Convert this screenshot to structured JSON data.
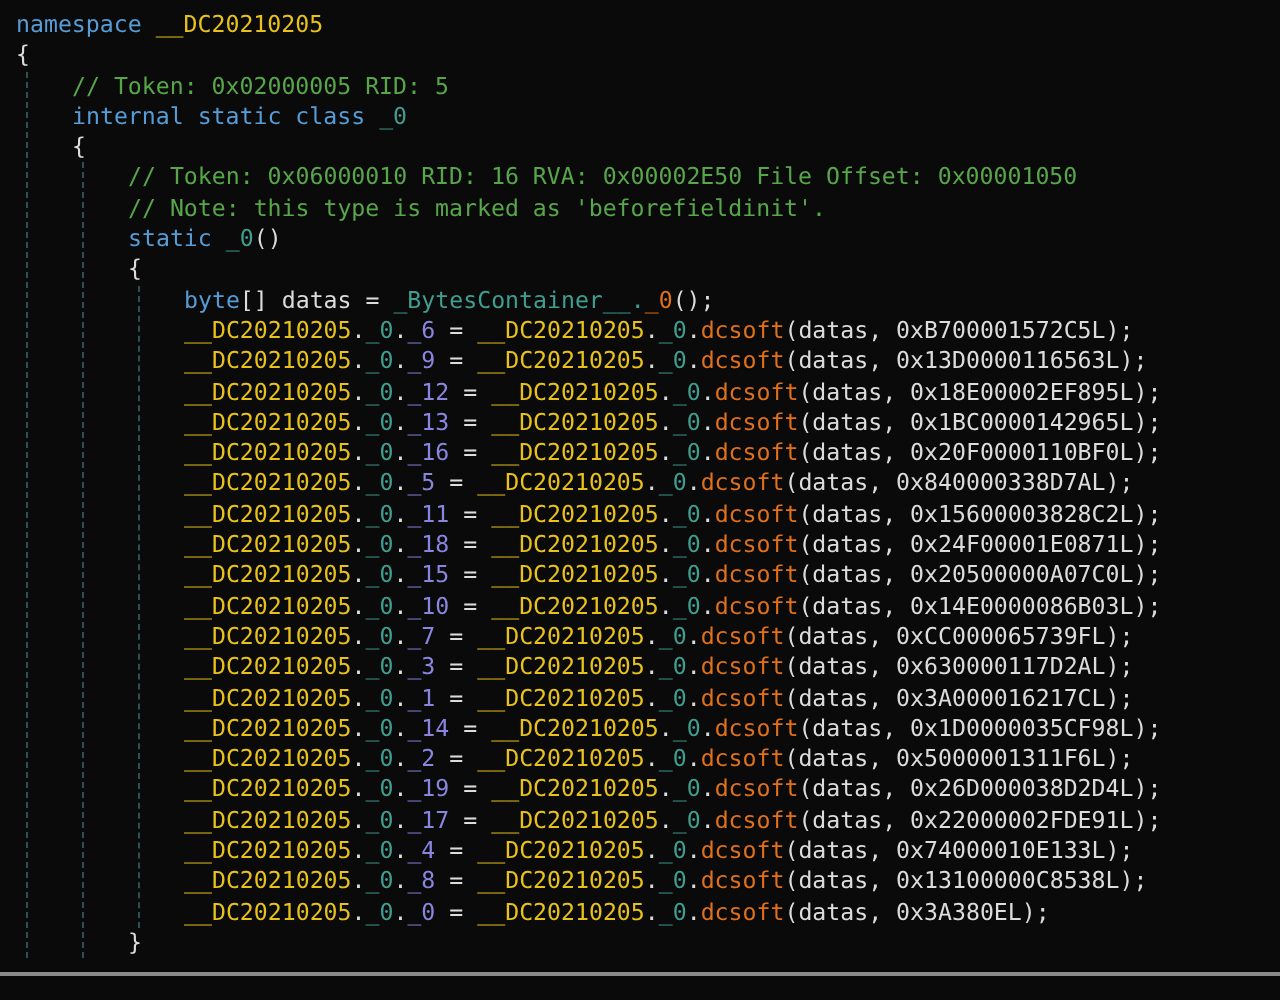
{
  "code_lines": [
    {
      "tokens": [
        {
          "kind": "kw",
          "text": "namespace "
        },
        {
          "kind": "type",
          "text": "__DC20210205"
        }
      ]
    },
    {
      "tokens": [
        {
          "kind": "text",
          "text": "{"
        }
      ],
      "children": [
        {
          "tokens": [
            {
              "kind": "comment",
              "text": "// Token: 0x02000005 RID: 5"
            }
          ]
        },
        {
          "tokens": [
            {
              "kind": "kw",
              "text": "internal static class "
            },
            {
              "kind": "cls",
              "text": "_0"
            }
          ]
        },
        {
          "tokens": [
            {
              "kind": "text",
              "text": "{"
            }
          ],
          "children": [
            {
              "tokens": [
                {
                  "kind": "comment",
                  "text": "// Token: 0x06000010 RID: 16 RVA: 0x00002E50 File Offset: 0x00001050"
                }
              ]
            },
            {
              "tokens": [
                {
                  "kind": "comment",
                  "text": "// Note: this type is marked as 'beforefieldinit'."
                }
              ]
            },
            {
              "tokens": [
                {
                  "kind": "kw",
                  "text": "static "
                },
                {
                  "kind": "cls",
                  "text": "_0"
                },
                {
                  "kind": "text",
                  "text": "()"
                }
              ]
            },
            {
              "tokens": [
                {
                  "kind": "text",
                  "text": "{"
                }
              ],
              "children": [
                {
                  "tokens": [
                    {
                      "kind": "kw",
                      "text": "byte"
                    },
                    {
                      "kind": "text",
                      "text": "[] datas = "
                    },
                    {
                      "kind": "cls",
                      "text": "_BytesContainer__."
                    },
                    {
                      "kind": "method",
                      "text": "_0"
                    },
                    {
                      "kind": "text",
                      "text": "();"
                    }
                  ]
                },
                {
                  "tokens": [
                    {
                      "kind": "type",
                      "text": "__DC20210205"
                    },
                    {
                      "kind": "text",
                      "text": "."
                    },
                    {
                      "kind": "cls",
                      "text": "_0"
                    },
                    {
                      "kind": "text",
                      "text": "."
                    },
                    {
                      "kind": "field",
                      "text": "_6"
                    },
                    {
                      "kind": "text",
                      "text": " = "
                    },
                    {
                      "kind": "type",
                      "text": "__DC20210205"
                    },
                    {
                      "kind": "text",
                      "text": "."
                    },
                    {
                      "kind": "cls",
                      "text": "_0"
                    },
                    {
                      "kind": "text",
                      "text": "."
                    },
                    {
                      "kind": "method",
                      "text": "dcsoft"
                    },
                    {
                      "kind": "text",
                      "text": "(datas, 0xB700001572C5L);"
                    }
                  ]
                },
                {
                  "tokens": [
                    {
                      "kind": "type",
                      "text": "__DC20210205"
                    },
                    {
                      "kind": "text",
                      "text": "."
                    },
                    {
                      "kind": "cls",
                      "text": "_0"
                    },
                    {
                      "kind": "text",
                      "text": "."
                    },
                    {
                      "kind": "field",
                      "text": "_9"
                    },
                    {
                      "kind": "text",
                      "text": " = "
                    },
                    {
                      "kind": "type",
                      "text": "__DC20210205"
                    },
                    {
                      "kind": "text",
                      "text": "."
                    },
                    {
                      "kind": "cls",
                      "text": "_0"
                    },
                    {
                      "kind": "text",
                      "text": "."
                    },
                    {
                      "kind": "method",
                      "text": "dcsoft"
                    },
                    {
                      "kind": "text",
                      "text": "(datas, 0x13D0000116563L);"
                    }
                  ]
                },
                {
                  "tokens": [
                    {
                      "kind": "type",
                      "text": "__DC20210205"
                    },
                    {
                      "kind": "text",
                      "text": "."
                    },
                    {
                      "kind": "cls",
                      "text": "_0"
                    },
                    {
                      "kind": "text",
                      "text": "."
                    },
                    {
                      "kind": "field",
                      "text": "_12"
                    },
                    {
                      "kind": "text",
                      "text": " = "
                    },
                    {
                      "kind": "type",
                      "text": "__DC20210205"
                    },
                    {
                      "kind": "text",
                      "text": "."
                    },
                    {
                      "kind": "cls",
                      "text": "_0"
                    },
                    {
                      "kind": "text",
                      "text": "."
                    },
                    {
                      "kind": "method",
                      "text": "dcsoft"
                    },
                    {
                      "kind": "text",
                      "text": "(datas, 0x18E00002EF895L);"
                    }
                  ]
                },
                {
                  "tokens": [
                    {
                      "kind": "type",
                      "text": "__DC20210205"
                    },
                    {
                      "kind": "text",
                      "text": "."
                    },
                    {
                      "kind": "cls",
                      "text": "_0"
                    },
                    {
                      "kind": "text",
                      "text": "."
                    },
                    {
                      "kind": "field",
                      "text": "_13"
                    },
                    {
                      "kind": "text",
                      "text": " = "
                    },
                    {
                      "kind": "type",
                      "text": "__DC20210205"
                    },
                    {
                      "kind": "text",
                      "text": "."
                    },
                    {
                      "kind": "cls",
                      "text": "_0"
                    },
                    {
                      "kind": "text",
                      "text": "."
                    },
                    {
                      "kind": "method",
                      "text": "dcsoft"
                    },
                    {
                      "kind": "text",
                      "text": "(datas, 0x1BC0000142965L);"
                    }
                  ]
                },
                {
                  "tokens": [
                    {
                      "kind": "type",
                      "text": "__DC20210205"
                    },
                    {
                      "kind": "text",
                      "text": "."
                    },
                    {
                      "kind": "cls",
                      "text": "_0"
                    },
                    {
                      "kind": "text",
                      "text": "."
                    },
                    {
                      "kind": "field",
                      "text": "_16"
                    },
                    {
                      "kind": "text",
                      "text": " = "
                    },
                    {
                      "kind": "type",
                      "text": "__DC20210205"
                    },
                    {
                      "kind": "text",
                      "text": "."
                    },
                    {
                      "kind": "cls",
                      "text": "_0"
                    },
                    {
                      "kind": "text",
                      "text": "."
                    },
                    {
                      "kind": "method",
                      "text": "dcsoft"
                    },
                    {
                      "kind": "text",
                      "text": "(datas, 0x20F0000110BF0L);"
                    }
                  ]
                },
                {
                  "tokens": [
                    {
                      "kind": "type",
                      "text": "__DC20210205"
                    },
                    {
                      "kind": "text",
                      "text": "."
                    },
                    {
                      "kind": "cls",
                      "text": "_0"
                    },
                    {
                      "kind": "text",
                      "text": "."
                    },
                    {
                      "kind": "field",
                      "text": "_5"
                    },
                    {
                      "kind": "text",
                      "text": " = "
                    },
                    {
                      "kind": "type",
                      "text": "__DC20210205"
                    },
                    {
                      "kind": "text",
                      "text": "."
                    },
                    {
                      "kind": "cls",
                      "text": "_0"
                    },
                    {
                      "kind": "text",
                      "text": "."
                    },
                    {
                      "kind": "method",
                      "text": "dcsoft"
                    },
                    {
                      "kind": "text",
                      "text": "(datas, 0x840000338D7AL);"
                    }
                  ]
                },
                {
                  "tokens": [
                    {
                      "kind": "type",
                      "text": "__DC20210205"
                    },
                    {
                      "kind": "text",
                      "text": "."
                    },
                    {
                      "kind": "cls",
                      "text": "_0"
                    },
                    {
                      "kind": "text",
                      "text": "."
                    },
                    {
                      "kind": "field",
                      "text": "_11"
                    },
                    {
                      "kind": "text",
                      "text": " = "
                    },
                    {
                      "kind": "type",
                      "text": "__DC20210205"
                    },
                    {
                      "kind": "text",
                      "text": "."
                    },
                    {
                      "kind": "cls",
                      "text": "_0"
                    },
                    {
                      "kind": "text",
                      "text": "."
                    },
                    {
                      "kind": "method",
                      "text": "dcsoft"
                    },
                    {
                      "kind": "text",
                      "text": "(datas, 0x15600003828C2L);"
                    }
                  ]
                },
                {
                  "tokens": [
                    {
                      "kind": "type",
                      "text": "__DC20210205"
                    },
                    {
                      "kind": "text",
                      "text": "."
                    },
                    {
                      "kind": "cls",
                      "text": "_0"
                    },
                    {
                      "kind": "text",
                      "text": "."
                    },
                    {
                      "kind": "field",
                      "text": "_18"
                    },
                    {
                      "kind": "text",
                      "text": " = "
                    },
                    {
                      "kind": "type",
                      "text": "__DC20210205"
                    },
                    {
                      "kind": "text",
                      "text": "."
                    },
                    {
                      "kind": "cls",
                      "text": "_0"
                    },
                    {
                      "kind": "text",
                      "text": "."
                    },
                    {
                      "kind": "method",
                      "text": "dcsoft"
                    },
                    {
                      "kind": "text",
                      "text": "(datas, 0x24F00001E0871L);"
                    }
                  ]
                },
                {
                  "tokens": [
                    {
                      "kind": "type",
                      "text": "__DC20210205"
                    },
                    {
                      "kind": "text",
                      "text": "."
                    },
                    {
                      "kind": "cls",
                      "text": "_0"
                    },
                    {
                      "kind": "text",
                      "text": "."
                    },
                    {
                      "kind": "field",
                      "text": "_15"
                    },
                    {
                      "kind": "text",
                      "text": " = "
                    },
                    {
                      "kind": "type",
                      "text": "__DC20210205"
                    },
                    {
                      "kind": "text",
                      "text": "."
                    },
                    {
                      "kind": "cls",
                      "text": "_0"
                    },
                    {
                      "kind": "text",
                      "text": "."
                    },
                    {
                      "kind": "method",
                      "text": "dcsoft"
                    },
                    {
                      "kind": "text",
                      "text": "(datas, 0x20500000A07C0L);"
                    }
                  ]
                },
                {
                  "tokens": [
                    {
                      "kind": "type",
                      "text": "__DC20210205"
                    },
                    {
                      "kind": "text",
                      "text": "."
                    },
                    {
                      "kind": "cls",
                      "text": "_0"
                    },
                    {
                      "kind": "text",
                      "text": "."
                    },
                    {
                      "kind": "field",
                      "text": "_10"
                    },
                    {
                      "kind": "text",
                      "text": " = "
                    },
                    {
                      "kind": "type",
                      "text": "__DC20210205"
                    },
                    {
                      "kind": "text",
                      "text": "."
                    },
                    {
                      "kind": "cls",
                      "text": "_0"
                    },
                    {
                      "kind": "text",
                      "text": "."
                    },
                    {
                      "kind": "method",
                      "text": "dcsoft"
                    },
                    {
                      "kind": "text",
                      "text": "(datas, 0x14E0000086B03L);"
                    }
                  ]
                },
                {
                  "tokens": [
                    {
                      "kind": "type",
                      "text": "__DC20210205"
                    },
                    {
                      "kind": "text",
                      "text": "."
                    },
                    {
                      "kind": "cls",
                      "text": "_0"
                    },
                    {
                      "kind": "text",
                      "text": "."
                    },
                    {
                      "kind": "field",
                      "text": "_7"
                    },
                    {
                      "kind": "text",
                      "text": " = "
                    },
                    {
                      "kind": "type",
                      "text": "__DC20210205"
                    },
                    {
                      "kind": "text",
                      "text": "."
                    },
                    {
                      "kind": "cls",
                      "text": "_0"
                    },
                    {
                      "kind": "text",
                      "text": "."
                    },
                    {
                      "kind": "method",
                      "text": "dcsoft"
                    },
                    {
                      "kind": "text",
                      "text": "(datas, 0xCC000065739FL);"
                    }
                  ]
                },
                {
                  "tokens": [
                    {
                      "kind": "type",
                      "text": "__DC20210205"
                    },
                    {
                      "kind": "text",
                      "text": "."
                    },
                    {
                      "kind": "cls",
                      "text": "_0"
                    },
                    {
                      "kind": "text",
                      "text": "."
                    },
                    {
                      "kind": "field",
                      "text": "_3"
                    },
                    {
                      "kind": "text",
                      "text": " = "
                    },
                    {
                      "kind": "type",
                      "text": "__DC20210205"
                    },
                    {
                      "kind": "text",
                      "text": "."
                    },
                    {
                      "kind": "cls",
                      "text": "_0"
                    },
                    {
                      "kind": "text",
                      "text": "."
                    },
                    {
                      "kind": "method",
                      "text": "dcsoft"
                    },
                    {
                      "kind": "text",
                      "text": "(datas, 0x630000117D2AL);"
                    }
                  ]
                },
                {
                  "tokens": [
                    {
                      "kind": "type",
                      "text": "__DC20210205"
                    },
                    {
                      "kind": "text",
                      "text": "."
                    },
                    {
                      "kind": "cls",
                      "text": "_0"
                    },
                    {
                      "kind": "text",
                      "text": "."
                    },
                    {
                      "kind": "field",
                      "text": "_1"
                    },
                    {
                      "kind": "text",
                      "text": " = "
                    },
                    {
                      "kind": "type",
                      "text": "__DC20210205"
                    },
                    {
                      "kind": "text",
                      "text": "."
                    },
                    {
                      "kind": "cls",
                      "text": "_0"
                    },
                    {
                      "kind": "text",
                      "text": "."
                    },
                    {
                      "kind": "method",
                      "text": "dcsoft"
                    },
                    {
                      "kind": "text",
                      "text": "(datas, 0x3A000016217CL);"
                    }
                  ]
                },
                {
                  "tokens": [
                    {
                      "kind": "type",
                      "text": "__DC20210205"
                    },
                    {
                      "kind": "text",
                      "text": "."
                    },
                    {
                      "kind": "cls",
                      "text": "_0"
                    },
                    {
                      "kind": "text",
                      "text": "."
                    },
                    {
                      "kind": "field",
                      "text": "_14"
                    },
                    {
                      "kind": "text",
                      "text": " = "
                    },
                    {
                      "kind": "type",
                      "text": "__DC20210205"
                    },
                    {
                      "kind": "text",
                      "text": "."
                    },
                    {
                      "kind": "cls",
                      "text": "_0"
                    },
                    {
                      "kind": "text",
                      "text": "."
                    },
                    {
                      "kind": "method",
                      "text": "dcsoft"
                    },
                    {
                      "kind": "text",
                      "text": "(datas, 0x1D0000035CF98L);"
                    }
                  ]
                },
                {
                  "tokens": [
                    {
                      "kind": "type",
                      "text": "__DC20210205"
                    },
                    {
                      "kind": "text",
                      "text": "."
                    },
                    {
                      "kind": "cls",
                      "text": "_0"
                    },
                    {
                      "kind": "text",
                      "text": "."
                    },
                    {
                      "kind": "field",
                      "text": "_2"
                    },
                    {
                      "kind": "text",
                      "text": " = "
                    },
                    {
                      "kind": "type",
                      "text": "__DC20210205"
                    },
                    {
                      "kind": "text",
                      "text": "."
                    },
                    {
                      "kind": "cls",
                      "text": "_0"
                    },
                    {
                      "kind": "text",
                      "text": "."
                    },
                    {
                      "kind": "method",
                      "text": "dcsoft"
                    },
                    {
                      "kind": "text",
                      "text": "(datas, 0x5000001311F6L);"
                    }
                  ]
                },
                {
                  "tokens": [
                    {
                      "kind": "type",
                      "text": "__DC20210205"
                    },
                    {
                      "kind": "text",
                      "text": "."
                    },
                    {
                      "kind": "cls",
                      "text": "_0"
                    },
                    {
                      "kind": "text",
                      "text": "."
                    },
                    {
                      "kind": "field",
                      "text": "_19"
                    },
                    {
                      "kind": "text",
                      "text": " = "
                    },
                    {
                      "kind": "type",
                      "text": "__DC20210205"
                    },
                    {
                      "kind": "text",
                      "text": "."
                    },
                    {
                      "kind": "cls",
                      "text": "_0"
                    },
                    {
                      "kind": "text",
                      "text": "."
                    },
                    {
                      "kind": "method",
                      "text": "dcsoft"
                    },
                    {
                      "kind": "text",
                      "text": "(datas, 0x26D000038D2D4L);"
                    }
                  ]
                },
                {
                  "tokens": [
                    {
                      "kind": "type",
                      "text": "__DC20210205"
                    },
                    {
                      "kind": "text",
                      "text": "."
                    },
                    {
                      "kind": "cls",
                      "text": "_0"
                    },
                    {
                      "kind": "text",
                      "text": "."
                    },
                    {
                      "kind": "field",
                      "text": "_17"
                    },
                    {
                      "kind": "text",
                      "text": " = "
                    },
                    {
                      "kind": "type",
                      "text": "__DC20210205"
                    },
                    {
                      "kind": "text",
                      "text": "."
                    },
                    {
                      "kind": "cls",
                      "text": "_0"
                    },
                    {
                      "kind": "text",
                      "text": "."
                    },
                    {
                      "kind": "method",
                      "text": "dcsoft"
                    },
                    {
                      "kind": "text",
                      "text": "(datas, 0x22000002FDE91L);"
                    }
                  ]
                },
                {
                  "tokens": [
                    {
                      "kind": "type",
                      "text": "__DC20210205"
                    },
                    {
                      "kind": "text",
                      "text": "."
                    },
                    {
                      "kind": "cls",
                      "text": "_0"
                    },
                    {
                      "kind": "text",
                      "text": "."
                    },
                    {
                      "kind": "field",
                      "text": "_4"
                    },
                    {
                      "kind": "text",
                      "text": " = "
                    },
                    {
                      "kind": "type",
                      "text": "__DC20210205"
                    },
                    {
                      "kind": "text",
                      "text": "."
                    },
                    {
                      "kind": "cls",
                      "text": "_0"
                    },
                    {
                      "kind": "text",
                      "text": "."
                    },
                    {
                      "kind": "method",
                      "text": "dcsoft"
                    },
                    {
                      "kind": "text",
                      "text": "(datas, 0x74000010E133L);"
                    }
                  ]
                },
                {
                  "tokens": [
                    {
                      "kind": "type",
                      "text": "__DC20210205"
                    },
                    {
                      "kind": "text",
                      "text": "."
                    },
                    {
                      "kind": "cls",
                      "text": "_0"
                    },
                    {
                      "kind": "text",
                      "text": "."
                    },
                    {
                      "kind": "field",
                      "text": "_8"
                    },
                    {
                      "kind": "text",
                      "text": " = "
                    },
                    {
                      "kind": "type",
                      "text": "__DC20210205"
                    },
                    {
                      "kind": "text",
                      "text": "."
                    },
                    {
                      "kind": "cls",
                      "text": "_0"
                    },
                    {
                      "kind": "text",
                      "text": "."
                    },
                    {
                      "kind": "method",
                      "text": "dcsoft"
                    },
                    {
                      "kind": "text",
                      "text": "(datas, 0x13100000C8538L);"
                    }
                  ]
                },
                {
                  "tokens": [
                    {
                      "kind": "type",
                      "text": "__DC20210205"
                    },
                    {
                      "kind": "text",
                      "text": "."
                    },
                    {
                      "kind": "cls",
                      "text": "_0"
                    },
                    {
                      "kind": "text",
                      "text": "."
                    },
                    {
                      "kind": "field",
                      "text": "_0"
                    },
                    {
                      "kind": "text",
                      "text": " = "
                    },
                    {
                      "kind": "type",
                      "text": "__DC20210205"
                    },
                    {
                      "kind": "text",
                      "text": "."
                    },
                    {
                      "kind": "cls",
                      "text": "_0"
                    },
                    {
                      "kind": "text",
                      "text": "."
                    },
                    {
                      "kind": "method",
                      "text": "dcsoft"
                    },
                    {
                      "kind": "text",
                      "text": "(datas, 0x3A380EL);"
                    }
                  ]
                }
              ]
            },
            {
              "tokens": [
                {
                  "kind": "text",
                  "text": "}"
                }
              ]
            }
          ]
        }
      ]
    }
  ]
}
